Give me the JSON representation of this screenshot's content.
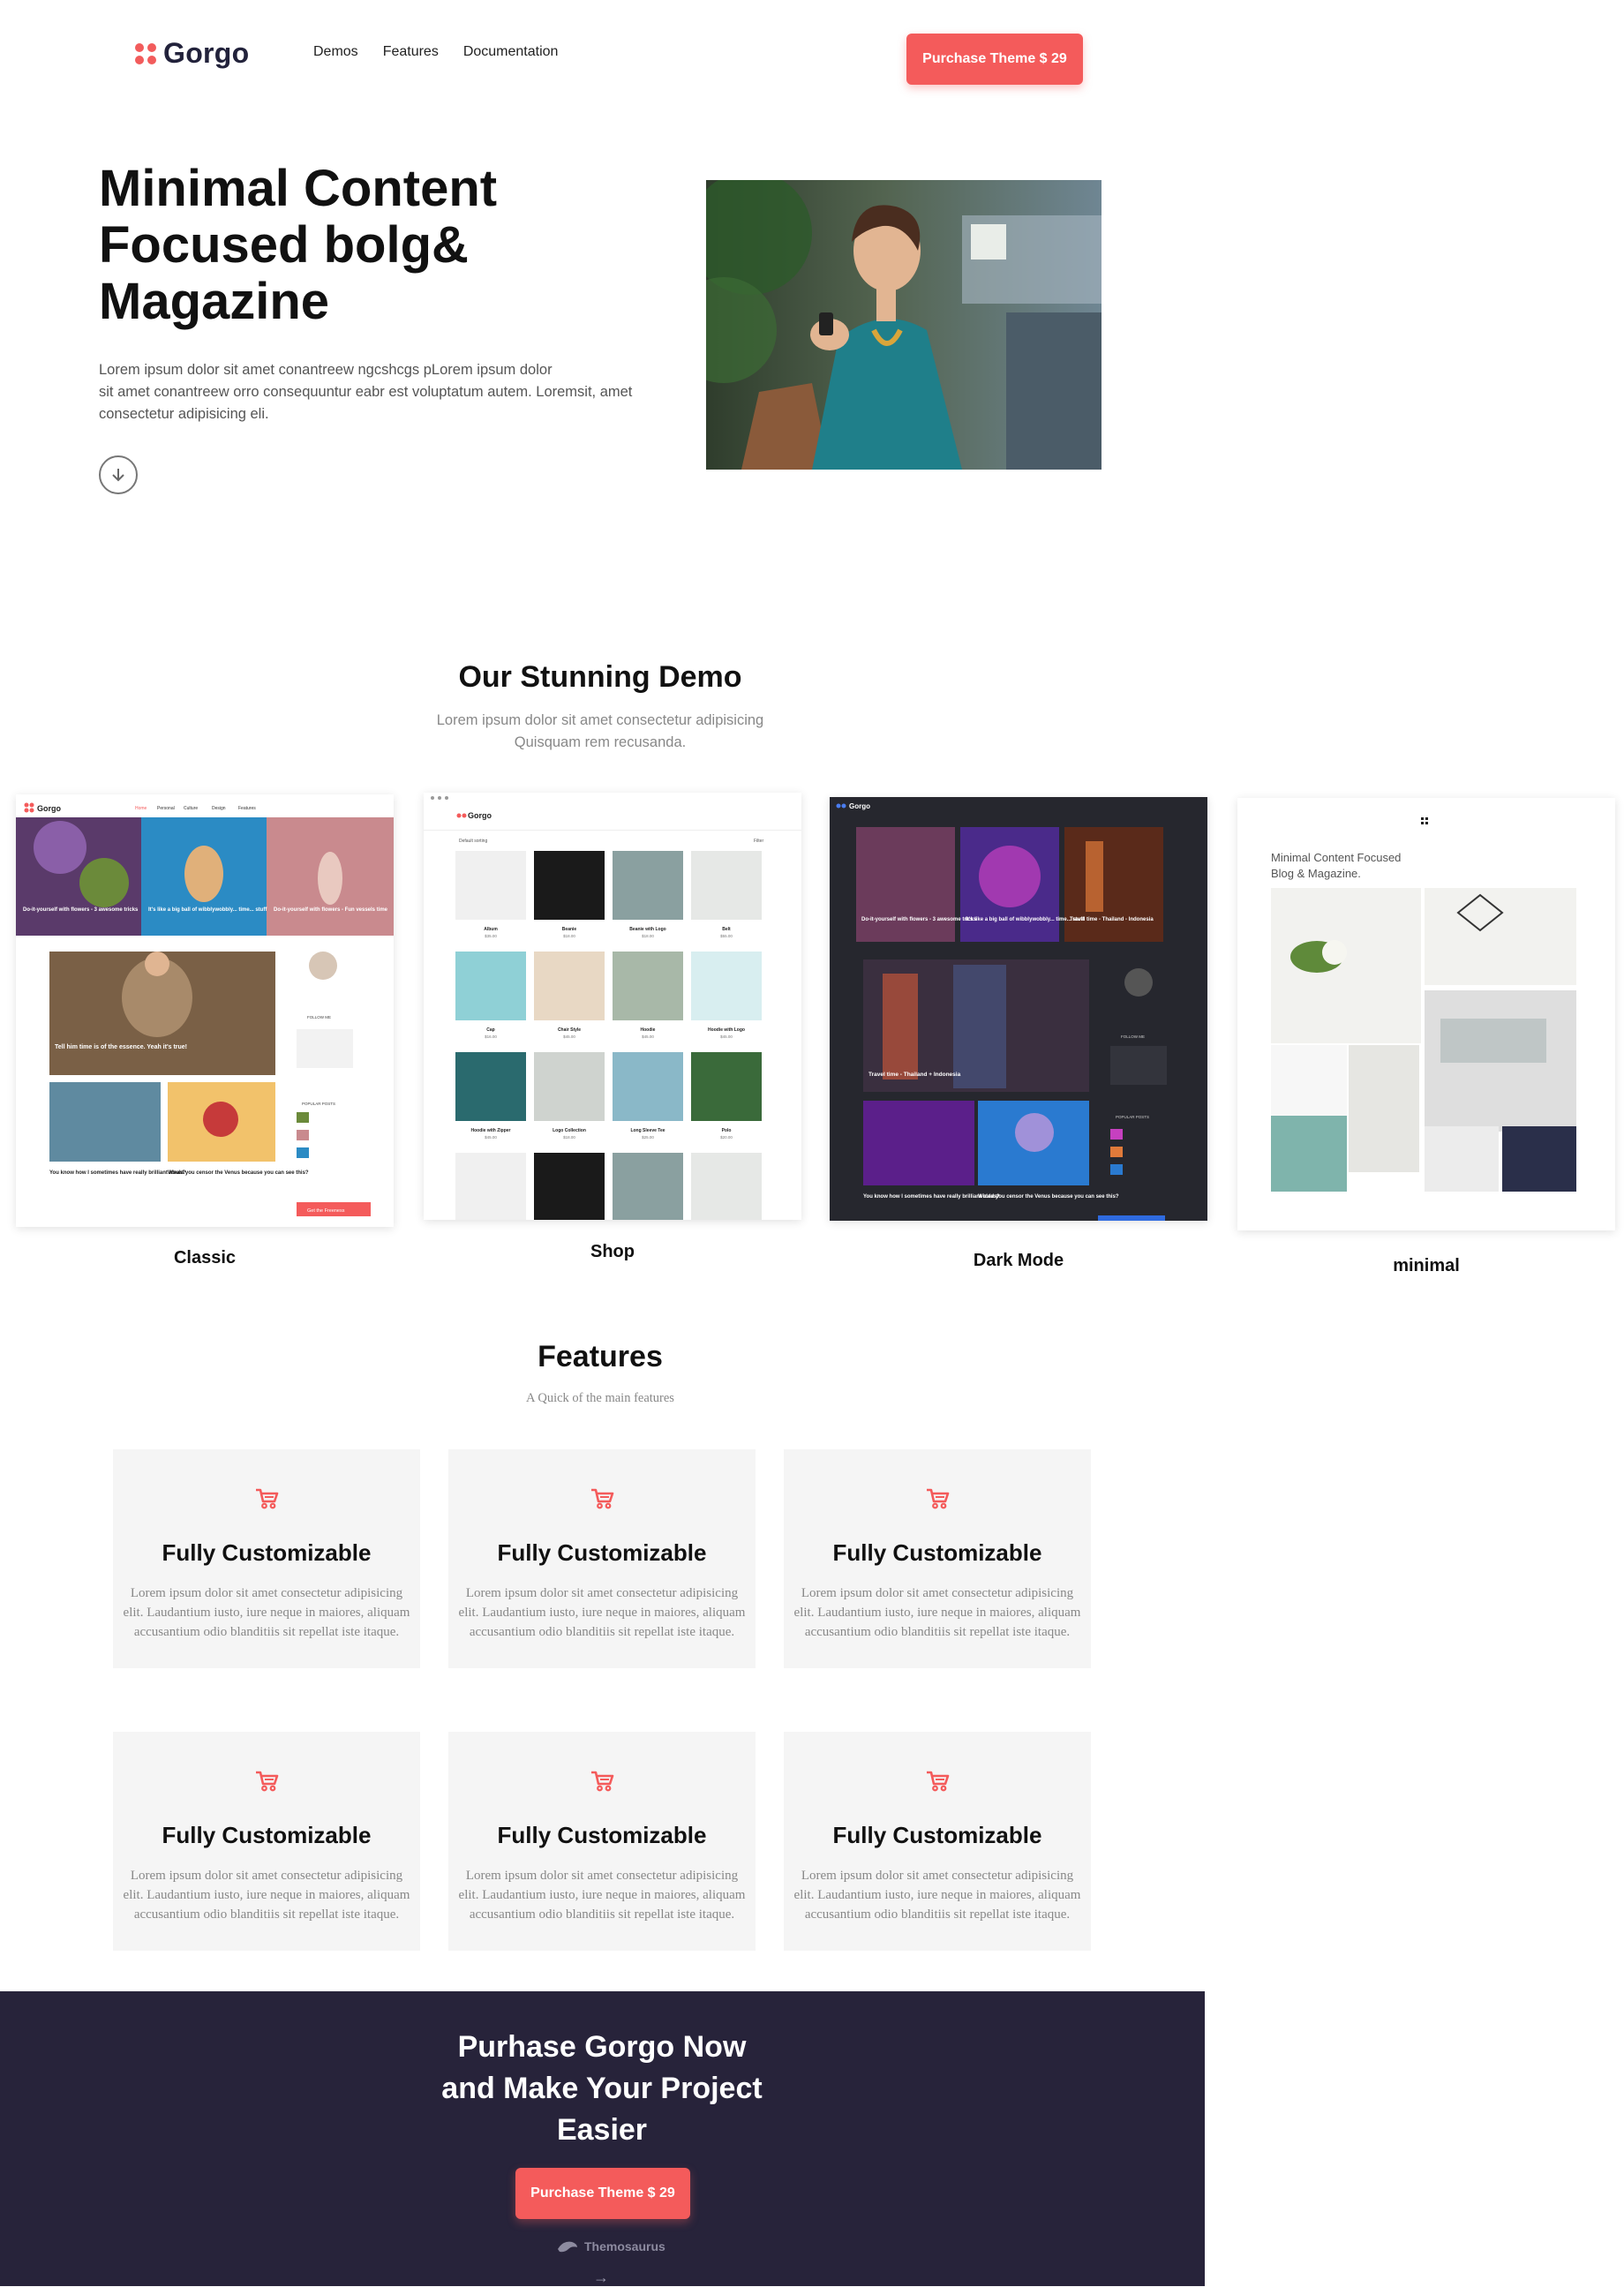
{
  "header": {
    "logo_text": "Gorgo",
    "nav": [
      "Demos",
      "Features",
      "Documentation"
    ],
    "cta_label": "Purchase Theme $ 29",
    "accent_color": "#f45b5b"
  },
  "hero": {
    "title_line1": "Minimal Content",
    "title_line2": "Focused bolg&",
    "title_line3": "Magazine",
    "text_line1": "Lorem ipsum dolor sit amet conantreew ngcshcgs pLorem ipsum dolor",
    "text_line2": "sit amet conantreew orro consequuntur eabr est voluptatum autem. Loremsit, amet",
    "text_line3": "consectetur adipisicing eli.",
    "scroll_icon": "arrow-down-circle-icon"
  },
  "demos": {
    "title": "Our Stunning Demo",
    "subtitle_line1": "Lorem ipsum dolor sit amet consectetur adipisicing",
    "subtitle_line2": "Quisquam rem recusanda.",
    "items": [
      {
        "label": "Classic"
      },
      {
        "label": "Shop"
      },
      {
        "label": "Dark Mode"
      },
      {
        "label": "minimal"
      }
    ],
    "classic": {
      "logo": "Gorgo",
      "nav": [
        "Home",
        "Personal",
        "Culture",
        "Design",
        "Features"
      ],
      "slides": [
        "Do-it-yourself with flowers - 3 awesome tricks",
        "It's like a big ball of wibblywobbly... time... stuff",
        "Do-it-yourself with flowers - Fun vessels time"
      ],
      "feature_post": "Tell him time is of the essence. Yeah it's true!",
      "posts": [
        "You know how I sometimes have really brilliant ideas?",
        "Would you censor the Venus because you can see this?"
      ],
      "sidebar_follow": "FOLLOW ME",
      "sidebar_popular": "POPULAR POSTS",
      "button": "Get the Freeness"
    },
    "shop": {
      "logo": "Gorgo",
      "sorting": "Default sorting",
      "filter": "Filter",
      "products": [
        {
          "name": "Album",
          "price": "$35.00"
        },
        {
          "name": "Beanie",
          "price": "$18.00"
        },
        {
          "name": "Beanie with Logo",
          "price": "$18.00"
        },
        {
          "name": "Belt",
          "price": "$55.00"
        },
        {
          "name": "Cap",
          "price": "$16.00"
        },
        {
          "name": "Chair Style",
          "price": "$45.00"
        },
        {
          "name": "Hoodie",
          "price": "$45.00"
        },
        {
          "name": "Hoodie with Logo",
          "price": "$45.00"
        },
        {
          "name": "Hoodie with Zipper",
          "price": "$45.00"
        },
        {
          "name": "Logo Collection",
          "price": "$18.00"
        },
        {
          "name": "Long Sleeve Tee",
          "price": "$25.00"
        },
        {
          "name": "Polo",
          "price": "$20.00"
        }
      ]
    },
    "dark": {
      "logo": "Gorgo",
      "slides": [
        "Do-it-yourself with flowers - 3 awesome tricks",
        "It's like a big ball of wibblywobbly... time... stuff",
        "Travel time - Thailand - Indonesia"
      ],
      "feature_post": "Travel time - Thailand + Indonesia",
      "posts": [
        "You know how I sometimes have really brilliant ideas?",
        "Would you censor the Venus because you can see this?"
      ],
      "sidebar_follow": "FOLLOW ME",
      "sidebar_popular": "POPULAR POSTS"
    },
    "minimal": {
      "tagline_line1": "Minimal Content Focused",
      "tagline_line2": "Blog & Magazine."
    }
  },
  "features": {
    "title": "Features",
    "subtitle": "A Quick of the main features",
    "icon": "shopping-cart-icon",
    "items": [
      {
        "title": "Fully Customizable",
        "text_line1": "Lorem ipsum dolor sit amet consectetur adipisicing",
        "text_line2": "elit. Laudantium iusto, iure neque in maiores, aliquam",
        "text_line3": "accusantium odio blanditiis sit repellat iste itaque."
      },
      {
        "title": "Fully Customizable",
        "text_line1": "Lorem ipsum dolor sit amet consectetur adipisicing",
        "text_line2": "elit. Laudantium iusto, iure neque in maiores, aliquam",
        "text_line3": "accusantium odio blanditiis sit repellat iste itaque."
      },
      {
        "title": "Fully Customizable",
        "text_line1": "Lorem ipsum dolor sit amet consectetur adipisicing",
        "text_line2": "elit. Laudantium iusto, iure neque in maiores, aliquam",
        "text_line3": "accusantium odio blanditiis sit repellat iste itaque."
      },
      {
        "title": "Fully Customizable",
        "text_line1": "Lorem ipsum dolor sit amet consectetur adipisicing",
        "text_line2": "elit. Laudantium iusto, iure neque in maiores, aliquam",
        "text_line3": "accusantium odio blanditiis sit repellat iste itaque."
      },
      {
        "title": "Fully Customizable",
        "text_line1": "Lorem ipsum dolor sit amet consectetur adipisicing",
        "text_line2": "elit. Laudantium iusto, iure neque in maiores, aliquam",
        "text_line3": "accusantium odio blanditiis sit repellat iste itaque."
      },
      {
        "title": "Fully Customizable",
        "text_line1": "Lorem ipsum dolor sit amet consectetur adipisicing",
        "text_line2": "elit. Laudantium iusto, iure neque in maiores, aliquam",
        "text_line3": "accusantium odio blanditiis sit repellat iste itaque."
      }
    ]
  },
  "cta": {
    "title_line1": "Purhase Gorgo Now",
    "title_line2": "and Make Your Project",
    "title_line3": "Easier",
    "button_label": "Purchase Theme $ 29",
    "brand": "Themosaurus",
    "arrow_icon": "arrow-right-icon",
    "background_color": "#27233a"
  }
}
